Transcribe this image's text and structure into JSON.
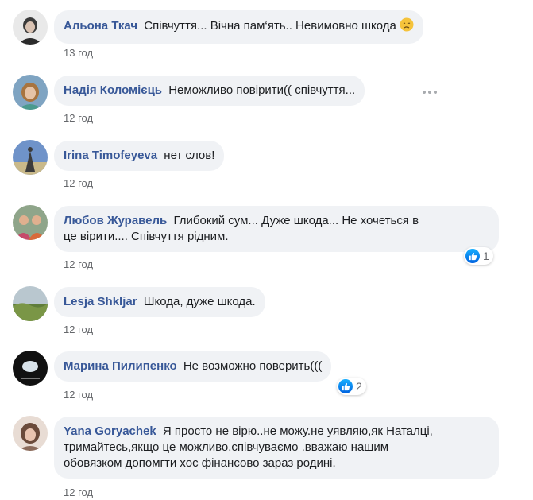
{
  "comments": [
    {
      "author": "Альона Ткач",
      "text": "Співчуття... Вічна пам‘ять.. Невимовно шкода",
      "emoji": "disappointed-face-emoji",
      "time": "13 год"
    },
    {
      "author": "Надія Коломієць",
      "text": "Неможливо повірити(( співчуття...",
      "time": "12 год"
    },
    {
      "author": "Irina Timofeyeva",
      "text": "нет слов!",
      "time": "12 год"
    },
    {
      "author": "Любов Журавель",
      "text": "Глибокий сум... Дуже шкода... Не хочеться в",
      "text2": "це вірити.... Співчуття рідним.",
      "time": "12 год",
      "reactions": "1"
    },
    {
      "author": "Lesja Shkljar",
      "text": "Шкода, дуже шкода.",
      "time": "12 год"
    },
    {
      "author": "Марина Пилипенко",
      "text": "Не возможно поверить(((",
      "time": "12 год",
      "reactions": "2"
    },
    {
      "author": "Yana Goryachek",
      "text": "Я просто не вірю..не можу.не уявляю,як Наталці,",
      "text2": "тримайтесь,якщо це можливо.співчуваємо .вважаю нашим",
      "text3": "обовязком допомгти хос фінансово зараз родині.",
      "time": "12 год"
    }
  ],
  "icons": {
    "like": "like-thumb-icon",
    "more": "more-options-icon"
  },
  "colors": {
    "author": "#385898",
    "bubble": "#f0f2f5",
    "like": "#1877f2",
    "timestamp": "#65676b"
  }
}
